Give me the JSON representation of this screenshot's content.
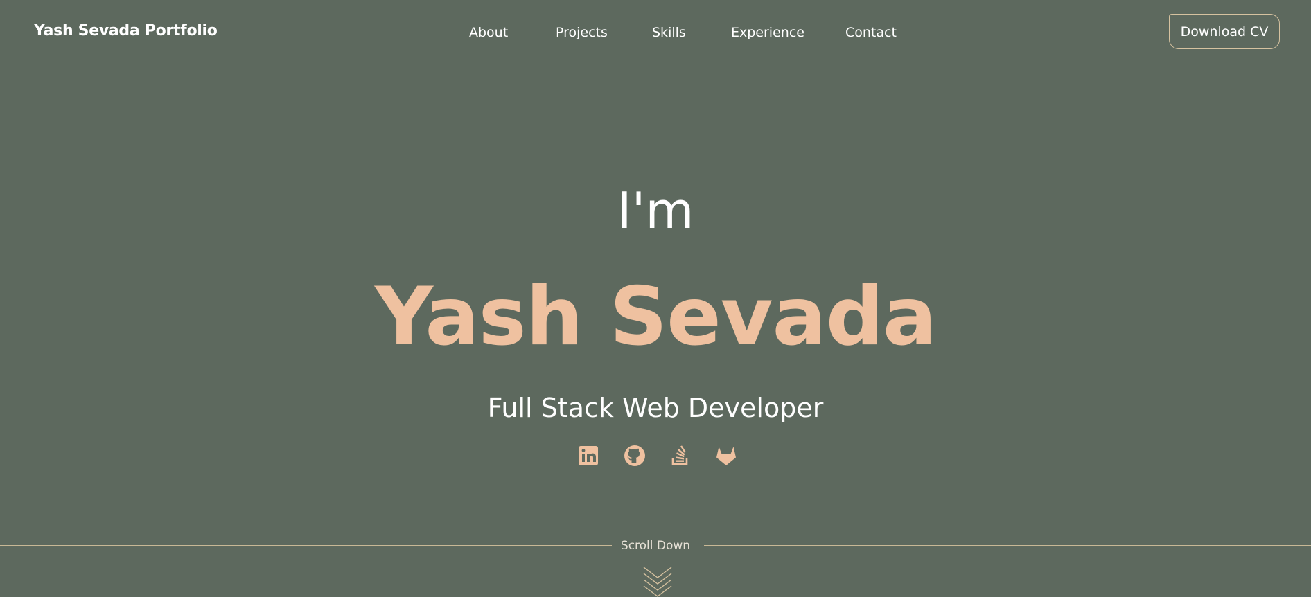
{
  "header": {
    "brand": "Yash Sevada Portfolio",
    "nav": [
      {
        "label": "About"
      },
      {
        "label": "Projects"
      },
      {
        "label": "Skills"
      },
      {
        "label": "Experience"
      },
      {
        "label": "Contact"
      }
    ],
    "cta_label": "Download CV"
  },
  "hero": {
    "intro": "I'm",
    "name": "Yash Sevada",
    "role": "Full Stack Web Developer",
    "socials": [
      {
        "icon": "linkedin-icon"
      },
      {
        "icon": "github-icon"
      },
      {
        "icon": "stackoverflow-icon"
      },
      {
        "icon": "gitlab-icon"
      }
    ]
  },
  "scroll": {
    "label": "Scroll Down"
  },
  "colors": {
    "background": "#5d695e",
    "accent": "#efc1a0",
    "outline": "#d6c2a0",
    "text": "#ffffff"
  }
}
